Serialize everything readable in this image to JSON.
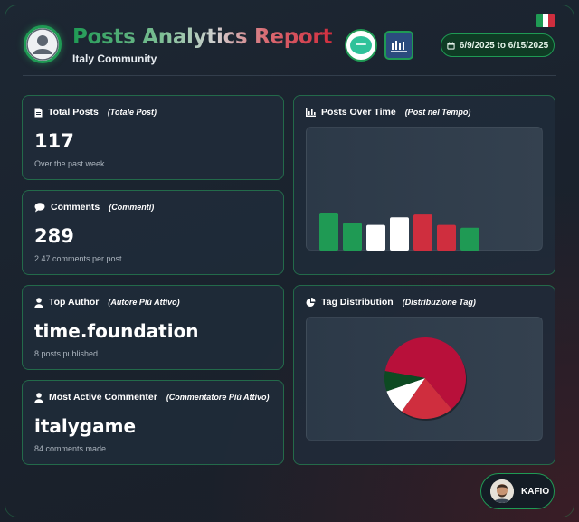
{
  "header": {
    "title": "Posts Analytics Report",
    "subtitle": "Italy Community",
    "date_range": "6/9/2025 to 6/15/2025",
    "flag_colors": [
      "#1f9a54",
      "#ffffff",
      "#cf2e3e"
    ]
  },
  "icons": {
    "avatar": "user-avatar-icon",
    "logo1": "chat-bubble-logo-icon",
    "logo2": "institution-logo-icon",
    "calendar": "calendar-icon",
    "file": "file-icon",
    "comment": "comment-icon",
    "user": "user-icon",
    "chart": "bar-chart-icon",
    "pie": "pie-chart-icon"
  },
  "cards": {
    "total_posts": {
      "label": "Total Posts",
      "sub": "(Totale Post)",
      "value": "117",
      "note": "Over the past week"
    },
    "comments": {
      "label": "Comments",
      "sub": "(Commenti)",
      "value": "289",
      "note": "2.47 comments per post"
    },
    "top_author": {
      "label": "Top Author",
      "sub": "(Autore Più Attivo)",
      "value": "time.foundation",
      "note": "8 posts published"
    },
    "top_commenter": {
      "label": "Most Active Commenter",
      "sub": "(Commentatore Più Attivo)",
      "value": "italygame",
      "note": "84 comments made"
    },
    "posts_over_time": {
      "label": "Posts Over Time",
      "sub": "(Post nel Tempo)"
    },
    "tag_distribution": {
      "label": "Tag Distribution",
      "sub": "(Distribuzione Tag)"
    }
  },
  "user": {
    "name": "KAFIO"
  },
  "colors": {
    "green": "#1f9a54",
    "white": "#ffffff",
    "red": "#cf2e3e",
    "crimson": "#b8103a",
    "darkgreen": "#0d4a22"
  },
  "chart_data": [
    {
      "type": "bar",
      "categories": [
        "",
        "",
        "",
        "",
        "",
        "",
        ""
      ],
      "values": [
        40,
        29,
        27,
        35,
        38,
        27,
        24
      ],
      "colors": [
        "#1f9a54",
        "#1f9a54",
        "#ffffff",
        "#ffffff",
        "#cf2e3e",
        "#cf2e3e",
        "#1f9a54"
      ],
      "title": "",
      "xlabel": "",
      "ylabel": "",
      "ylim": [
        0,
        40
      ],
      "grid": false
    },
    {
      "type": "pie",
      "values": [
        61,
        21,
        10,
        8
      ],
      "colors": [
        "#b8103a",
        "#cf2e3e",
        "#ffffff",
        "#0d4a22"
      ],
      "labels": [
        "",
        "",
        "",
        ""
      ]
    }
  ]
}
